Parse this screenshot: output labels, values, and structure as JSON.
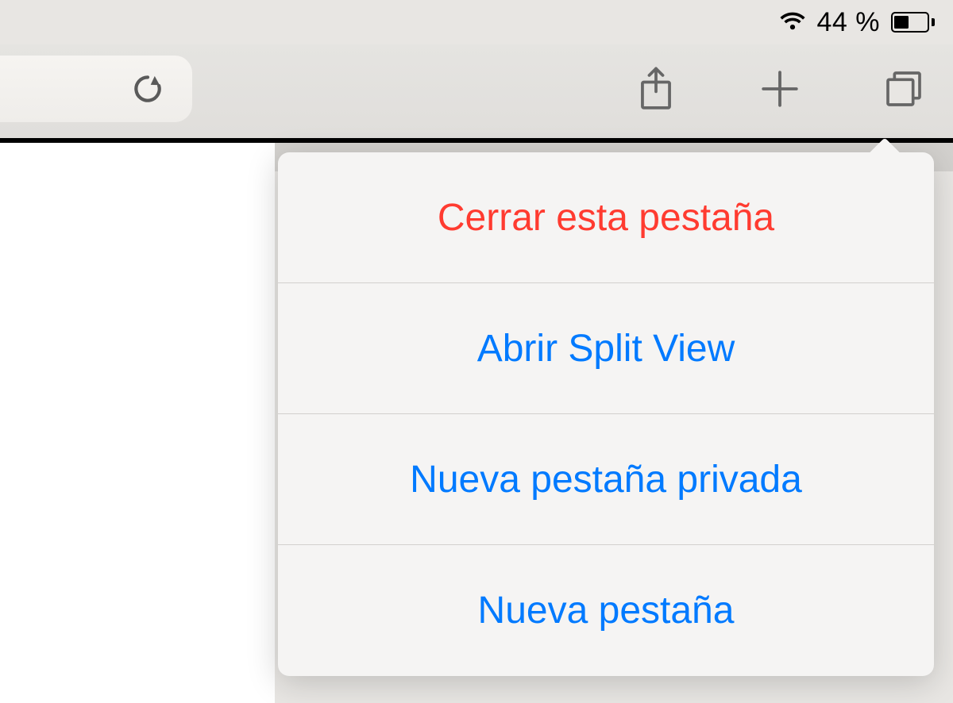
{
  "status": {
    "battery_pct": "44 %"
  },
  "popover_menu": {
    "items": [
      {
        "label": "Cerrar esta pestaña",
        "kind": "destructive"
      },
      {
        "label": "Abrir Split View",
        "kind": "default"
      },
      {
        "label": "Nueva pestaña privada",
        "kind": "default"
      },
      {
        "label": "Nueva pestaña",
        "kind": "default"
      }
    ]
  },
  "colors": {
    "accent_blue": "#007aff",
    "destructive_red": "#ff3b30"
  }
}
